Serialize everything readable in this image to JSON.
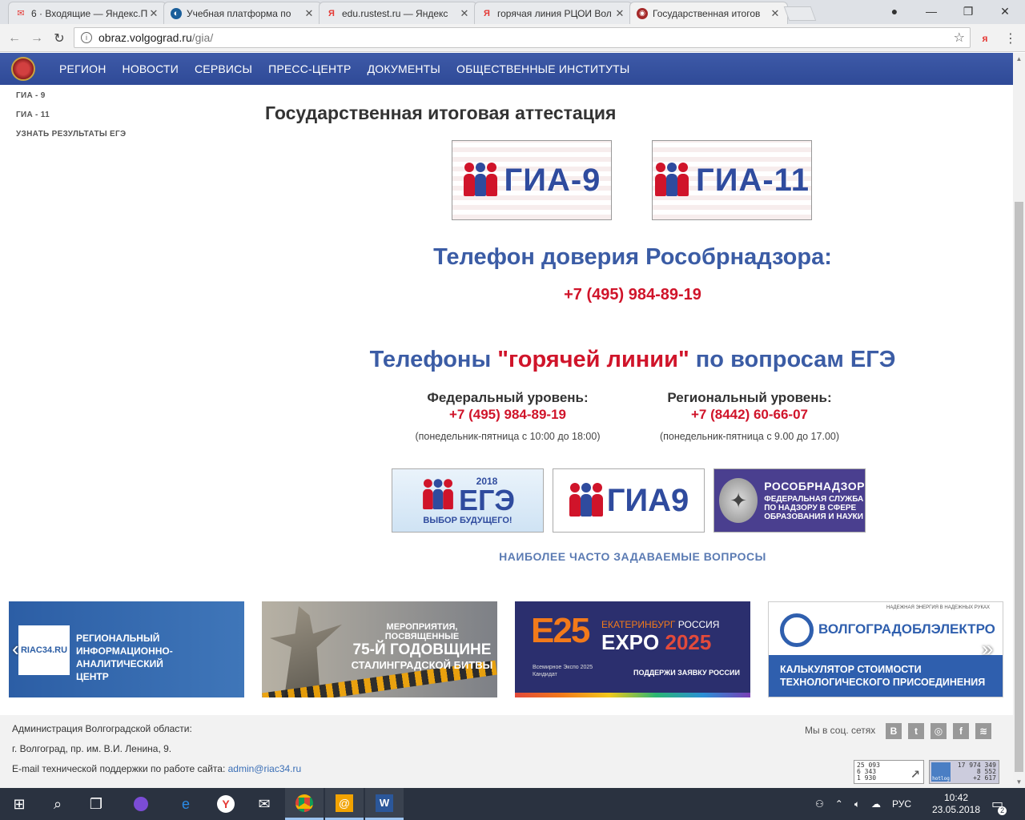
{
  "browser": {
    "tabs": [
      {
        "title": "6 · Входящие — Яндекс.П",
        "favicon": "mail-icon"
      },
      {
        "title": "Учебная платформа по ",
        "favicon": "platform-icon"
      },
      {
        "title": "edu.rustest.ru — Яндекс",
        "favicon": "yandex-icon"
      },
      {
        "title": "горячая линия РЦОИ Вол",
        "favicon": "yandex-icon"
      },
      {
        "title": "Государственная итогов",
        "favicon": "site-icon"
      }
    ],
    "url_host": "obraz.volgograd.ru",
    "url_path": "/gia/"
  },
  "nav": {
    "items": [
      "РЕГИОН",
      "НОВОСТИ",
      "СЕРВИСЫ",
      "ПРЕСС-ЦЕНТР",
      "ДОКУМЕНТЫ",
      "ОБЩЕСТВЕННЫЕ ИНСТИТУТЫ"
    ]
  },
  "sidebar": {
    "items": [
      "ГИА - 9",
      "ГИА - 11",
      "УЗНАТЬ РЕЗУЛЬТАТЫ ЕГЭ"
    ]
  },
  "main": {
    "title": "Государственная итоговая аттестация",
    "gia_banners": [
      "ГИА-9",
      "ГИА-11"
    ],
    "trust_title": "Телефон доверия Рособрнадзора:",
    "trust_phone": "+7 (495) 984-89-19",
    "ege_title_pre": "Телефоны ",
    "ege_title_red": "\"горячей линии\"",
    "ege_title_post": " по вопросам ЕГЭ",
    "federal": {
      "label": "Федеральный уровень:",
      "phone": "+7 (495) 984-89-19",
      "hours": "(понедельник-пятница с 10:00 до 18:00)"
    },
    "regional": {
      "label": "Региональный уровень:",
      "phone": "+7 (8442) 60-66-07",
      "hours": "(понедельник-пятница с 9.00 до 17.00)"
    },
    "ege_banner": {
      "year": "2018",
      "text": "ЕГЭ",
      "sub": "ВЫБОР БУДУЩЕГО!"
    },
    "gia9_banner": {
      "text": "ГИА9"
    },
    "rosobr_banner": {
      "title": "РОСОБРНАДЗОР",
      "sub1": "ФЕДЕРАЛЬНАЯ СЛУЖБА",
      "sub2": "ПО НАДЗОРУ В СФЕРЕ",
      "sub3": "ОБРАЗОВАНИЯ И НАУКИ"
    },
    "faq": "НАИБОЛЕЕ ЧАСТО ЗАДАВАЕМЫЕ ВОПРОСЫ"
  },
  "banners": {
    "riac": {
      "logo": "RIAC34.RU",
      "l1": "РЕГИОНАЛЬНЫЙ",
      "l2": "ИНФОРМАЦИОННО-АНАЛИТИЧЕСКИЙ",
      "l3": "ЦЕНТР"
    },
    "stalingrad": {
      "l1": "МЕРОПРИЯТИЯ, ПОСВЯЩЕННЫЕ",
      "l2": "75-Й ГОДОВЩИНЕ",
      "l3": "СТАЛИНГРАДСКОЙ БИТВЫ"
    },
    "expo": {
      "logo": "E25",
      "city": "ЕКАТЕРИНБУРГ",
      "country": "РОССИЯ",
      "expo": "EXPO",
      "year": "2025",
      "sub1": "Всемирное Экспо 2025",
      "sub2": "Кандидат",
      "slogan": "ПОДДЕРЖИ ЗАЯВКУ РОССИИ"
    },
    "vge": {
      "tag": "НАДЕЖНАЯ ЭНЕРГИЯ В НАДЕЖНЫХ РУКАХ",
      "name": "ВОЛГОГРАДОБЛЭЛЕКТРО",
      "l1": "КАЛЬКУЛЯТОР СТОИМОСТИ",
      "l2": "ТЕХНОЛОГИЧЕСКОГО ПРИСОЕДИНЕНИЯ"
    }
  },
  "footer": {
    "org": "Администрация Волгоградской области:",
    "address": "г. Волгоград, пр. им. В.И. Ленина, 9.",
    "support_label": "E-mail технической поддержки по работе сайта: ",
    "support_email": "admin@riac34.ru",
    "social_label": "Мы в соц. сетях",
    "social_icons": [
      "В",
      "t",
      "◎",
      "f",
      "≋"
    ],
    "counter1": [
      "25 093",
      "6 343",
      "1 930"
    ],
    "counter2": [
      "17 974 349",
      "8 552",
      "+2 617"
    ],
    "hotlog": "hotlog"
  },
  "taskbar": {
    "lang": "РУС",
    "time": "10:42",
    "date": "23.05.2018",
    "notifications": "2"
  },
  "colors": {
    "header_blue": "#3e5aa8",
    "title_blue": "#3b5ca5",
    "accent_red": "#d0142a"
  }
}
